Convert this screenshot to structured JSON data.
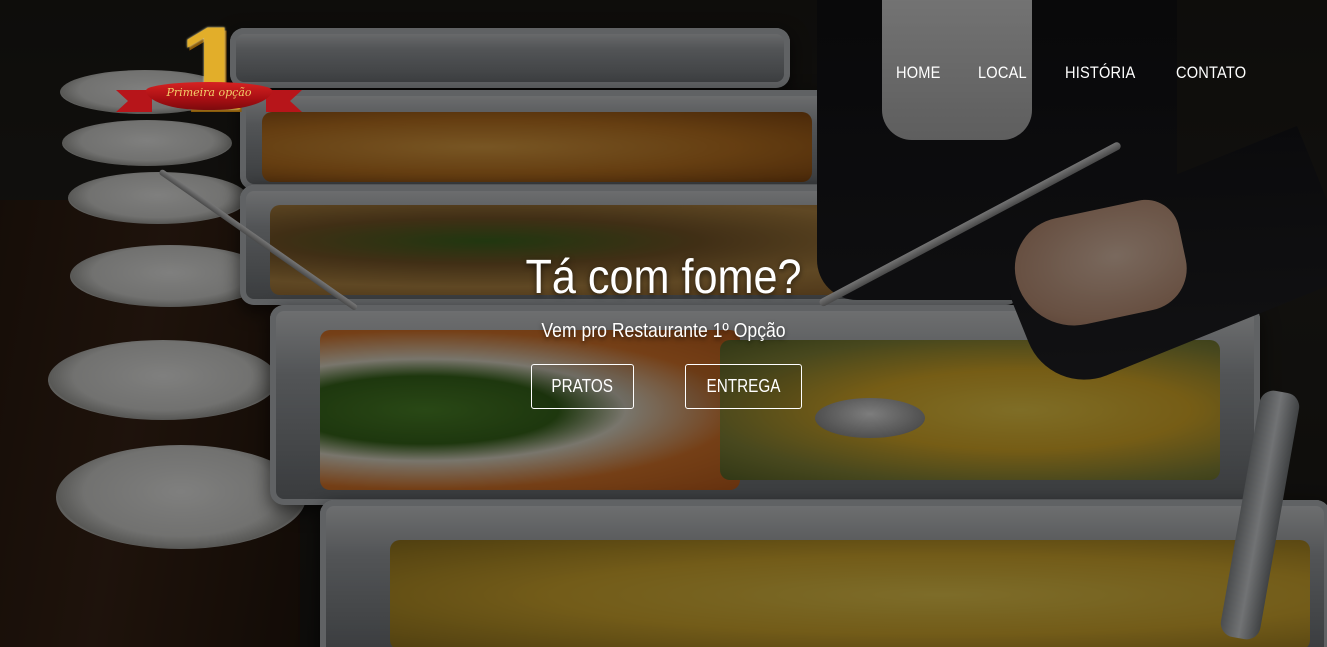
{
  "logo": {
    "numeral": "1",
    "ribbon_text": "Primeira opção"
  },
  "nav": {
    "items": [
      {
        "label": "HOME"
      },
      {
        "label": "LOCAL"
      },
      {
        "label": "HISTÓRIA"
      },
      {
        "label": "CONTATO"
      }
    ]
  },
  "hero": {
    "headline": "Tá com fome?",
    "subtitle": "Vem pro Restaurante 1º Opção",
    "buttons": [
      {
        "label": "PRATOS"
      },
      {
        "label": "ENTREGA"
      }
    ]
  }
}
